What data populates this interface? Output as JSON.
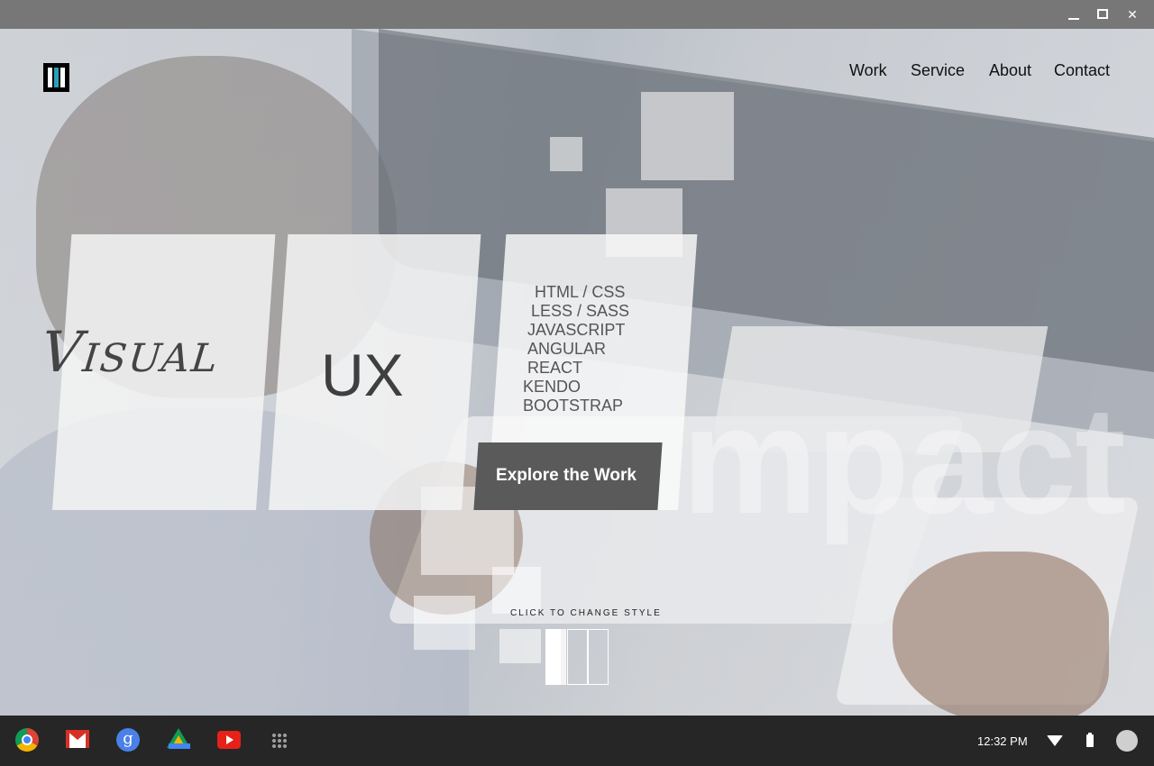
{
  "window": {
    "minimize_icon": "minimize-icon",
    "maximize_icon": "maximize-icon",
    "close_label": "✕"
  },
  "site": {
    "logo_icon": "bars-logo-icon",
    "accent": "#2aa0b8",
    "nav": [
      {
        "label": "Work"
      },
      {
        "label": "Service"
      },
      {
        "label": "About"
      },
      {
        "label": "Contact"
      }
    ],
    "hero": {
      "visual_label": "Visual",
      "ux_label": "UX",
      "skills": [
        "HTML / CSS",
        "LESS / SASS",
        "JAVASCRIPT",
        "ANGULAR",
        "REACT",
        "KENDO",
        "BOOTSTRAP"
      ],
      "cta_label": "Explore the Work",
      "background_word": "mpact"
    },
    "style_switcher": {
      "label": "CLICK TO CHANGE STYLE"
    }
  },
  "shelf": {
    "apps": [
      {
        "name": "chrome-icon"
      },
      {
        "name": "gmail-icon"
      },
      {
        "name": "google-icon",
        "glyph": "g"
      },
      {
        "name": "drive-icon"
      },
      {
        "name": "youtube-icon"
      },
      {
        "name": "launcher-icon"
      }
    ],
    "clock": "12:32 PM",
    "colors": {
      "background": "#262626"
    }
  }
}
